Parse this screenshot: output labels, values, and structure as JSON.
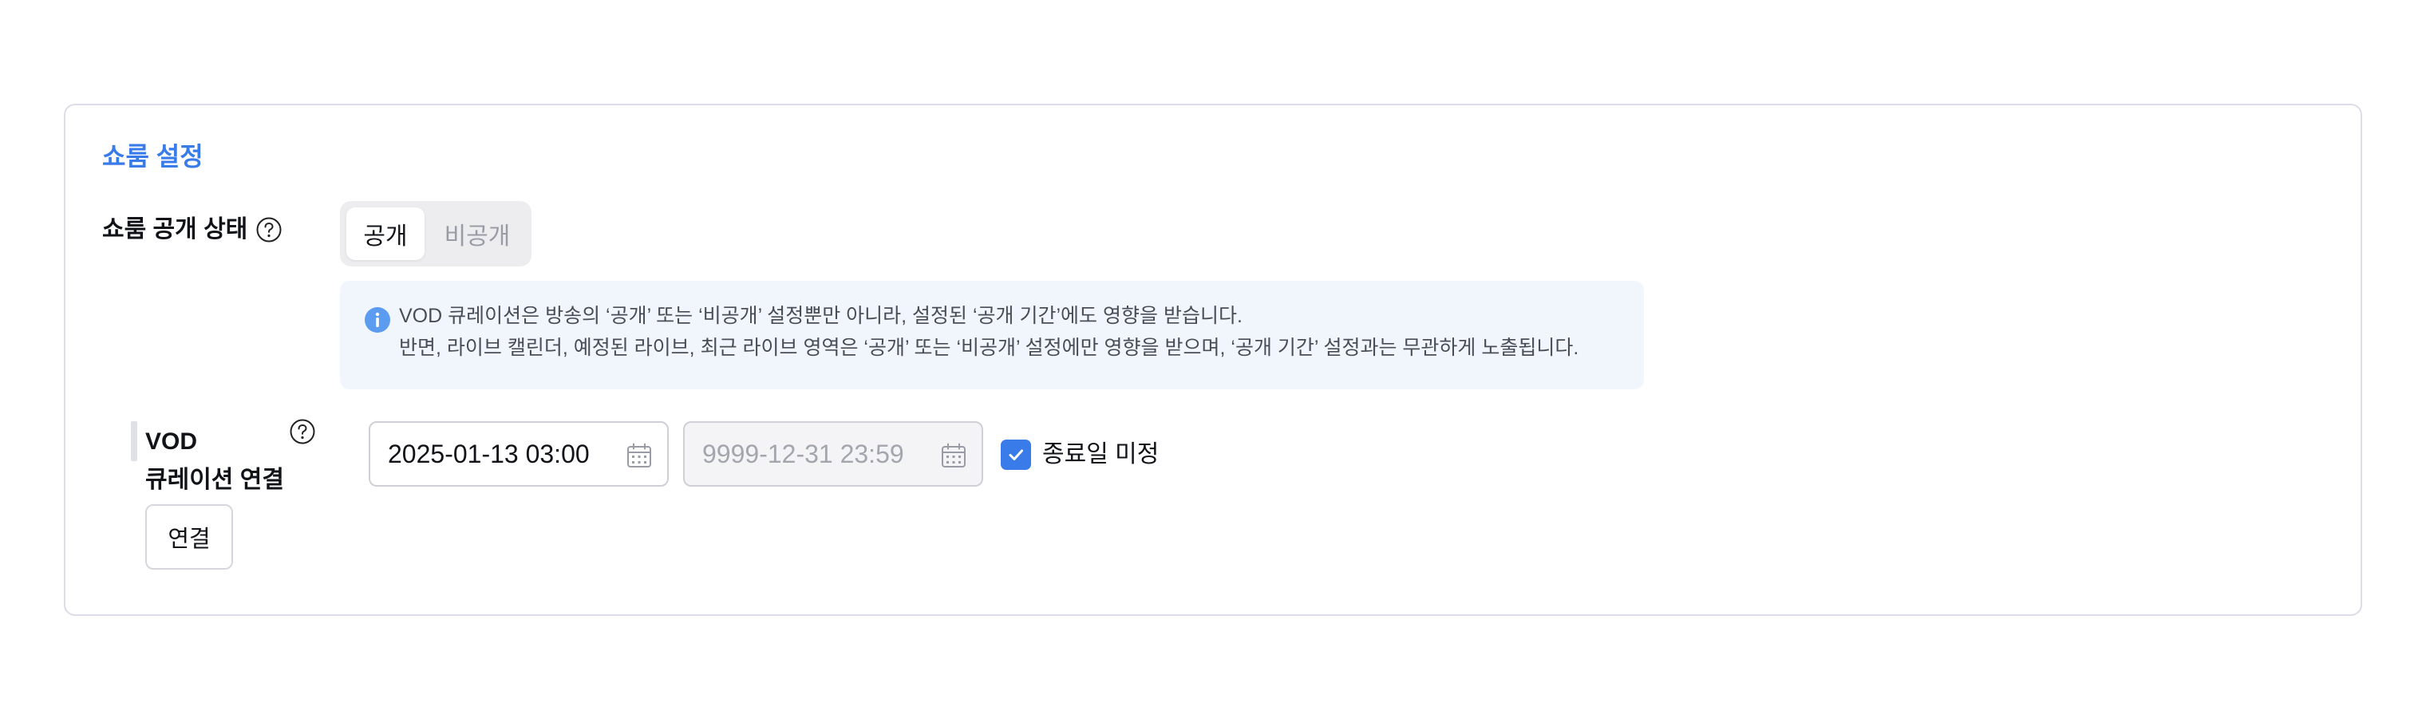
{
  "section": {
    "title": "쇼룸 설정"
  },
  "visibility": {
    "label": "쇼룸 공개 상태",
    "options": [
      "공개",
      "비공개"
    ],
    "selected": "공개"
  },
  "notice": {
    "line1": "VOD 큐레이션은 방송의 ‘공개’ 또는 ‘비공개’ 설정뿐만 아니라, 설정된 ‘공개 기간’에도 영향을 받습니다.",
    "line2": "반면, 라이브 캘린더, 예정된 라이브, 최근 라이브 영역은 ‘공개’ 또는 ‘비공개’ 설정에만 영향을 받으며, ‘공개 기간’ 설정과는 무관하게 노출됩니다."
  },
  "vod": {
    "label_line1": "VOD",
    "label_line2": "큐레이션 연결",
    "connect_label": "연결",
    "start_value": "2025-01-13 03:00",
    "end_placeholder": "9999-12-31 23:59",
    "no_end_label": "종료일 미정",
    "no_end_checked": true
  },
  "colors": {
    "accent": "#3a7bea",
    "info_bg": "#f1f6fd",
    "border": "#dcdde6"
  },
  "icons": [
    "help-icon",
    "info-icon",
    "calendar-icon",
    "check-icon"
  ]
}
